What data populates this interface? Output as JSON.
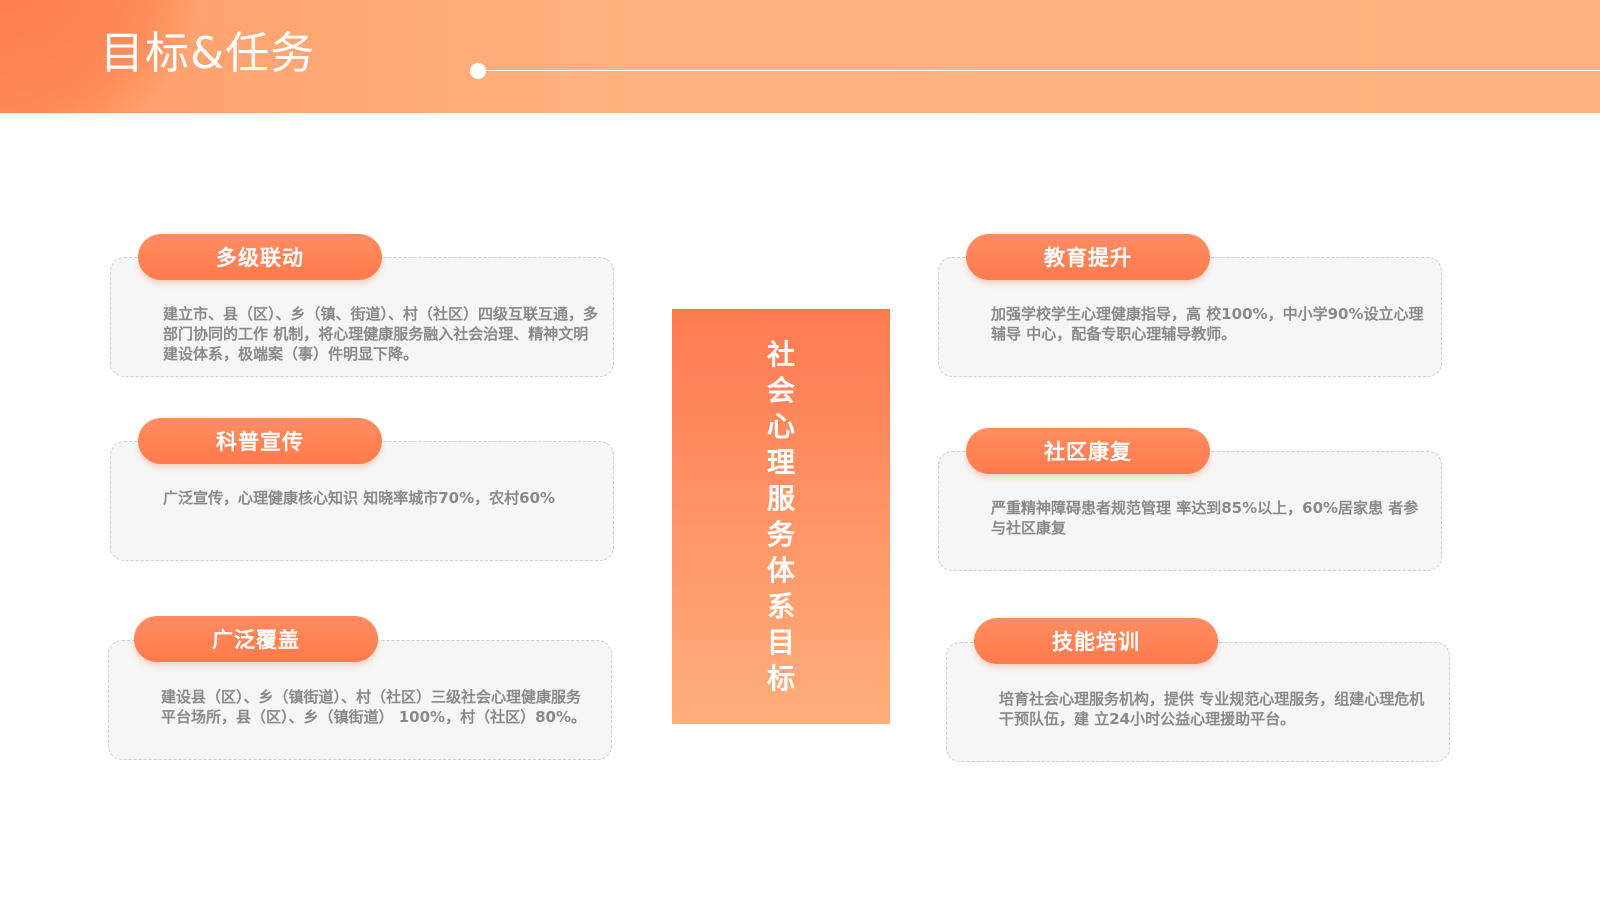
{
  "header": {
    "title": "目标&任务"
  },
  "center": {
    "chars": [
      "社",
      "会",
      "心",
      "理",
      "服",
      "务",
      "体",
      "系",
      "目",
      "标"
    ]
  },
  "cards": [
    {
      "label": "多级联动",
      "text": "建立市、县（区）、乡（镇、街道）、村（社区）四级互联互通，多部门协同的工作 机制，将心理健康服务融入社会治理、精神文明建设体系，极端案（事）件明显下降。"
    },
    {
      "label": "科普宣传",
      "text": "广泛宣传，心理健康核心知识 知晓率城市70%，农村60%"
    },
    {
      "label": "广泛覆盖",
      "text": "建设县（区）、乡（镇街道）、村（社区）三级社会心理健康服务 平台场所，县（区）、乡（镇街道） 100%，村（社区）80%。"
    },
    {
      "label": "教育提升",
      "text": "加强学校学生心理健康指导，高 校100%，中小学90%设立心理辅导 中心，配备专职心理辅导教师。"
    },
    {
      "label": "社区康复",
      "text": "严重精神障碍患者规范管理 率达到85%以上，60%居家患 者参与社区康复"
    },
    {
      "label": "技能培训",
      "text": "培育社会心理服务机构，提供 专业规范心理服务，组建心理危机干预队伍，建 立24小时公益心理援助平台。"
    }
  ],
  "colors": {
    "accent": "#ff7a4c",
    "header": "#ffb27d",
    "card_bg": "#f6f6f6",
    "text": "#8a8a8a"
  }
}
